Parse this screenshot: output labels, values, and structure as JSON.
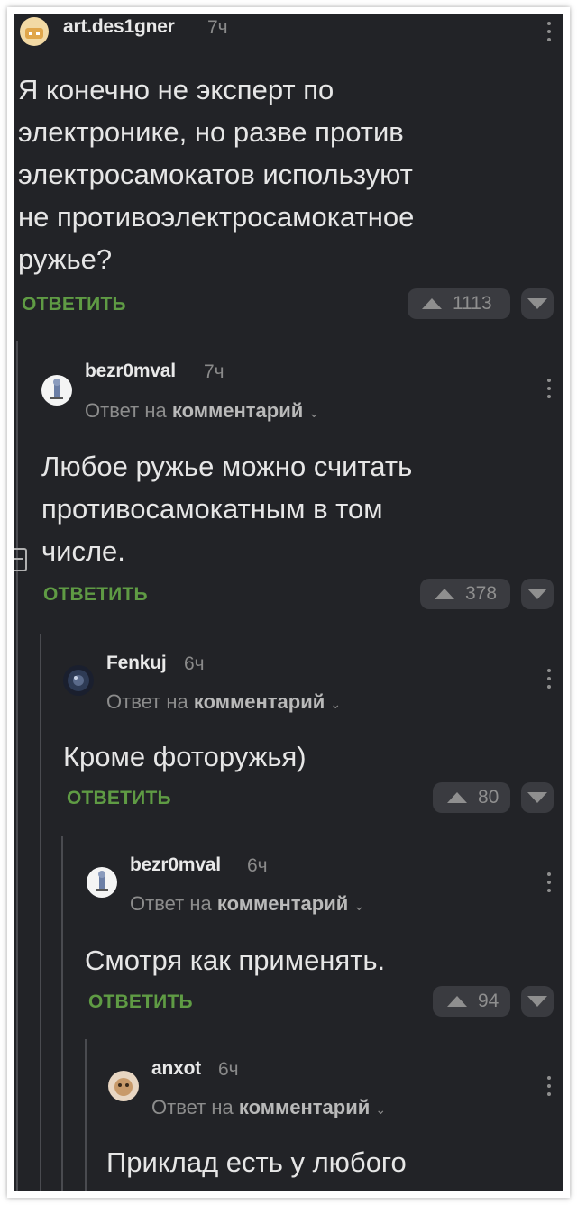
{
  "comments": [
    {
      "username": "art.des1gner",
      "time": "7ч",
      "reply_prefix": "",
      "reply_target": "",
      "body_lines": [
        "Я конечно не эксперт по",
        "электронике, но разве против",
        "электросамокатов используют",
        "не противоэлектросамокатное",
        "ружье?"
      ],
      "reply_label": "ОТВЕТИТЬ",
      "votes": "1113"
    },
    {
      "username": "bezr0mval",
      "time": "7ч",
      "reply_prefix": "Ответ на",
      "reply_target": "комментарий",
      "body_lines": [
        "Любое ружье можно считать",
        "противосамокатным в том",
        "числе."
      ],
      "reply_label": "ОТВЕТИТЬ",
      "votes": "378"
    },
    {
      "username": "Fenkuj",
      "time": "6ч",
      "reply_prefix": "Ответ на",
      "reply_target": "комментарий",
      "body_lines": [
        "Кроме фоторужья)"
      ],
      "reply_label": "ОТВЕТИТЬ",
      "votes": "80"
    },
    {
      "username": "bezr0mval",
      "time": "6ч",
      "reply_prefix": "Ответ на",
      "reply_target": "комментарий",
      "body_lines": [
        "Смотря как применять."
      ],
      "reply_label": "ОТВЕТИТЬ",
      "votes": "94"
    },
    {
      "username": "anxot",
      "time": "6ч",
      "reply_prefix": "Ответ на",
      "reply_target": "комментарий",
      "body_lines": [
        "Приклад есть у любого"
      ],
      "reply_label": "",
      "votes": ""
    }
  ],
  "colors": {
    "background": "#222327",
    "reply_link": "#5f9b44",
    "vote_bg": "#3a3b40"
  },
  "icons": {
    "upvote": "upvote-arrow-icon",
    "downvote": "downvote-arrow-icon",
    "menu": "more-vertical-icon",
    "chevron": "chevron-down-icon",
    "collapse": "collapse-thread-icon"
  }
}
